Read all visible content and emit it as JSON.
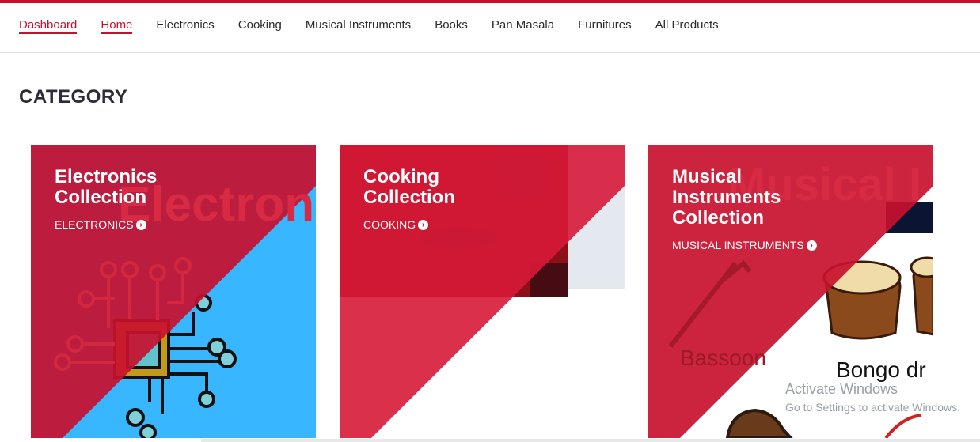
{
  "nav": {
    "items": [
      {
        "label": "Dashboard",
        "active": true
      },
      {
        "label": "Home",
        "active": true
      },
      {
        "label": "Electronics",
        "active": false
      },
      {
        "label": "Cooking",
        "active": false
      },
      {
        "label": "Musical Instruments",
        "active": false
      },
      {
        "label": "Books",
        "active": false
      },
      {
        "label": "Pan Masala",
        "active": false
      },
      {
        "label": "Furnitures",
        "active": false
      },
      {
        "label": "All Products",
        "active": false
      }
    ]
  },
  "page": {
    "title": "CATEGORY"
  },
  "cards": [
    {
      "title_line1": "Electronics",
      "title_line2": "Collection",
      "link": "ELECTRONICS",
      "bg_word": "Electron",
      "icon": "circuit-chip-icon"
    },
    {
      "title_line1": "Cooking",
      "title_line2": "Collection",
      "link": "COOKING",
      "icon": "cooking-photo"
    },
    {
      "title_line1": "Musical",
      "title_line2": "Instruments",
      "title_line3": "Collection",
      "link": "MUSICAL INSTRUMENTS",
      "bg_word": "Musical I",
      "label_bassoon": "Bassoon",
      "label_bongo": "Bongo dr",
      "icon": "bongo-drums-icon"
    }
  ],
  "watermark": {
    "line1": "Activate Windows",
    "line2": "Go to Settings to activate Windows."
  },
  "colors": {
    "accent": "#c8102e",
    "electronics_bg": "#38b6ff"
  }
}
